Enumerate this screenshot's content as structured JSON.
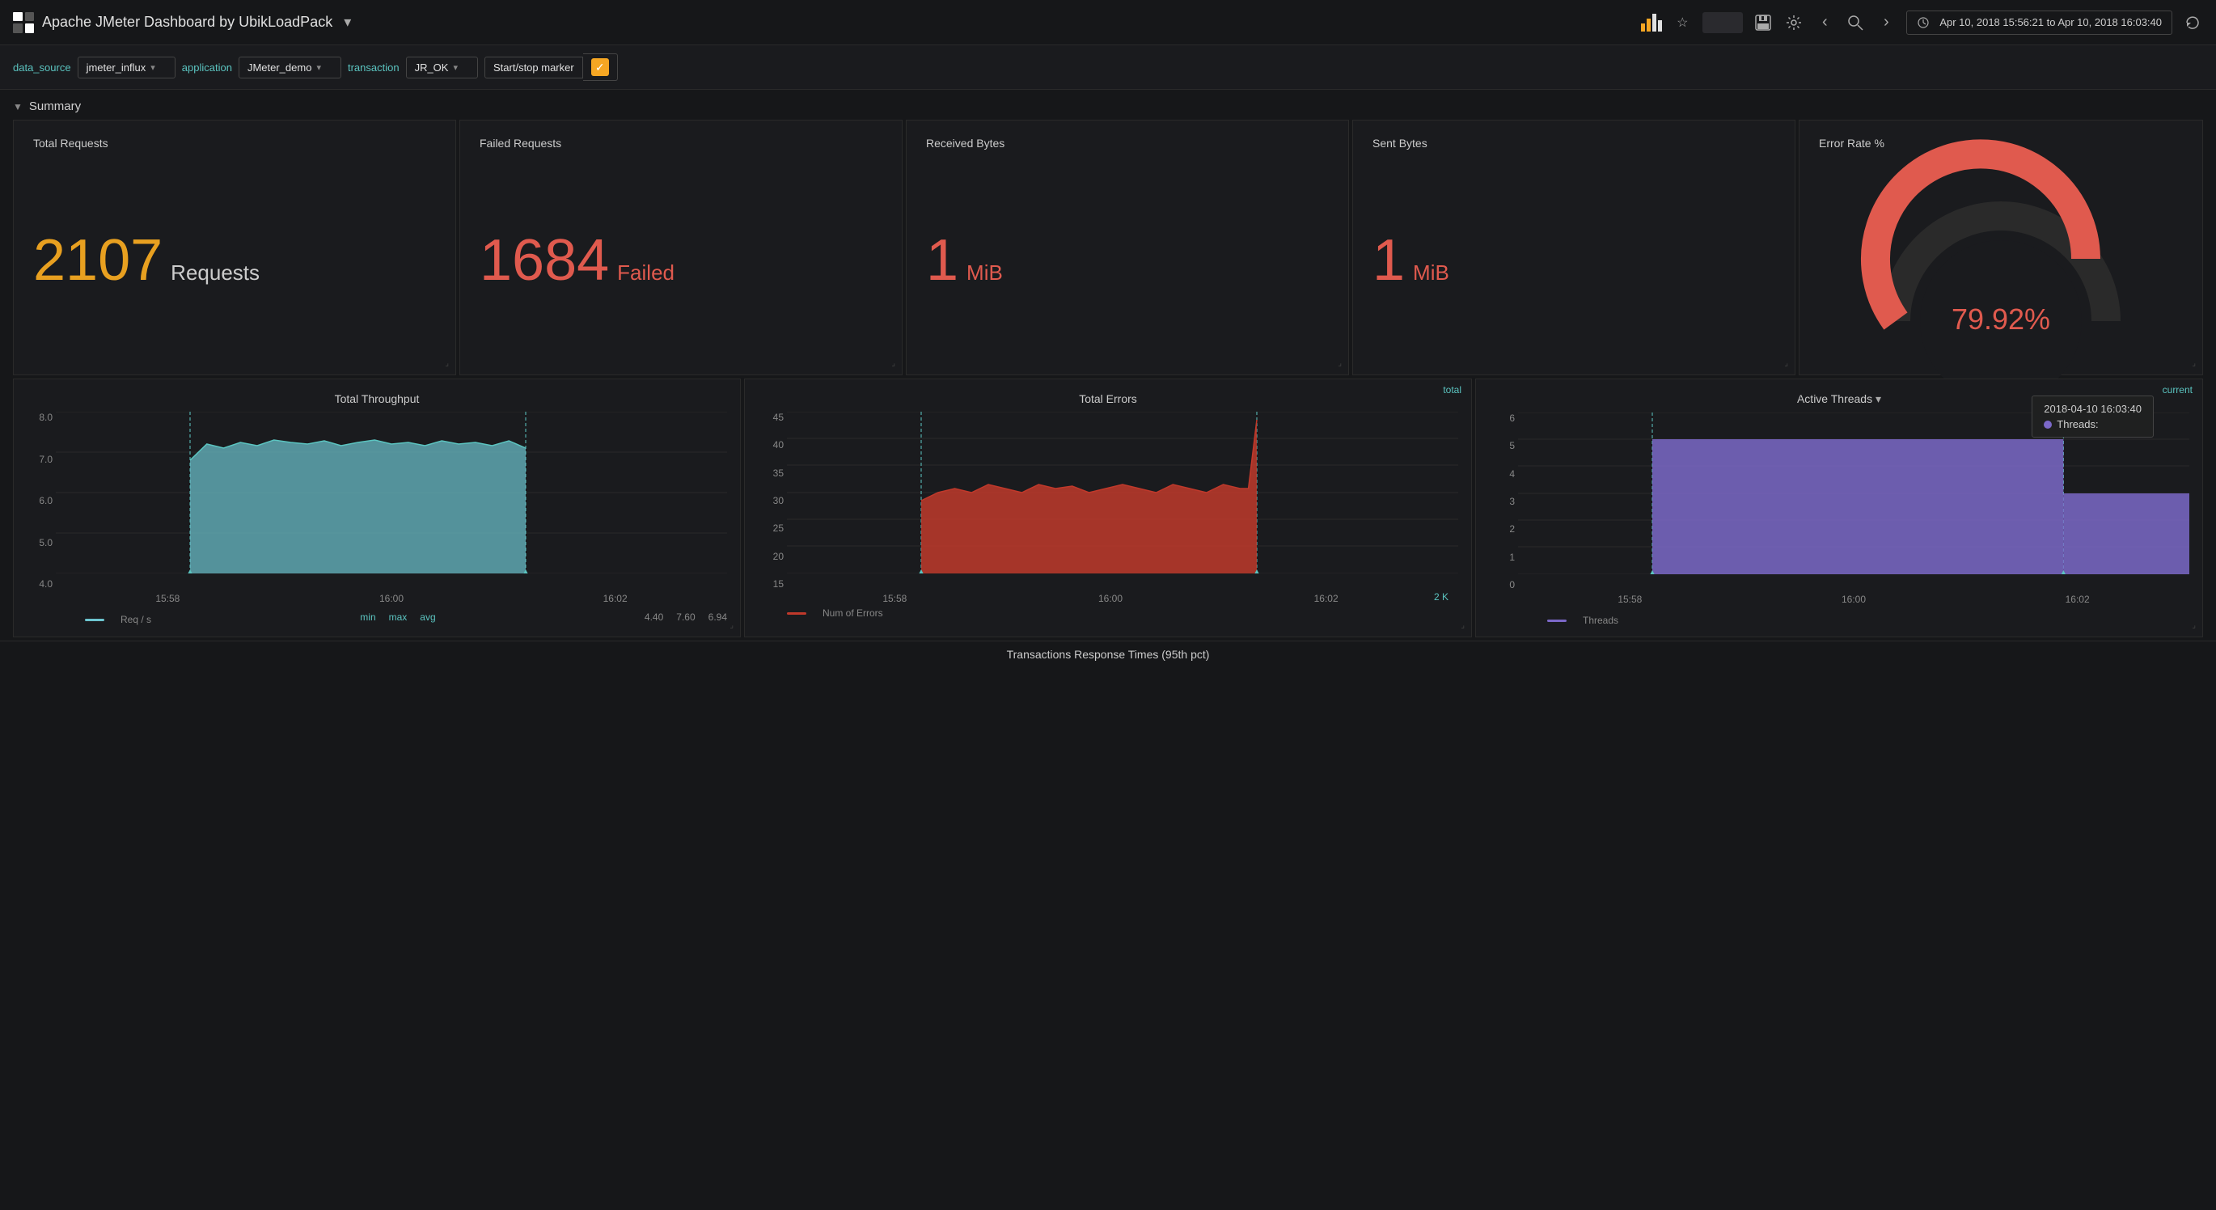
{
  "app": {
    "title": "Apache JMeter Dashboard by UbikLoadPack",
    "caret": "▾"
  },
  "topnav": {
    "star_label": "☆",
    "save_label": "💾",
    "settings_label": "⚙",
    "prev_label": "‹",
    "next_label": "›",
    "search_label": "🔍",
    "refresh_label": "↻",
    "time_range": "Apr 10, 2018  15:56:21  to  Apr 10, 2018  16:03:40"
  },
  "filterbar": {
    "data_source_label": "data_source",
    "data_source_value": "jmeter_influx",
    "application_label": "application",
    "application_value": "JMeter_demo",
    "transaction_label": "transaction",
    "transaction_value": "JR_OK",
    "start_stop_label": "Start/stop marker",
    "checkbox_checked": "✓"
  },
  "summary": {
    "section_label": "Summary",
    "collapse_icon": "▼"
  },
  "stat_cards": [
    {
      "title": "Total Requests",
      "big_num": "2107",
      "unit": "Requests",
      "num_color": "yellow",
      "unit_color": "white"
    },
    {
      "title": "Failed Requests",
      "big_num": "1684",
      "unit": "Failed",
      "num_color": "red",
      "unit_color": "red"
    },
    {
      "title": "Received Bytes",
      "big_num": "1",
      "unit": "MiB",
      "num_color": "red",
      "unit_color": "red"
    },
    {
      "title": "Sent Bytes",
      "big_num": "1",
      "unit": "MiB",
      "num_color": "red",
      "unit_color": "red"
    }
  ],
  "error_rate": {
    "title": "Error Rate %",
    "value": "79.92%",
    "percent": 79.92
  },
  "charts": [
    {
      "title": "Total Throughput",
      "y_labels": [
        "8.0",
        "7.0",
        "6.0",
        "5.0",
        "4.0"
      ],
      "x_labels": [
        "15:58",
        "16:00",
        "16:02"
      ],
      "legend_label": "Req / s",
      "legend_color": "#6dc5d0",
      "stats_min_label": "min",
      "stats_max_label": "max",
      "stats_avg_label": "avg",
      "stats_min": "4.40",
      "stats_max": "7.60",
      "stats_avg": "6.94",
      "type": "throughput"
    },
    {
      "title": "Total Errors",
      "y_labels": [
        "45",
        "40",
        "35",
        "30",
        "25",
        "20",
        "15"
      ],
      "x_labels": [
        "15:58",
        "16:00",
        "16:02"
      ],
      "legend_label": "Num of Errors",
      "legend_color": "#c0392b",
      "total_label": "total",
      "total_value": "2 K",
      "type": "errors"
    },
    {
      "title": "Active Threads",
      "title_caret": "▾",
      "y_labels": [
        "6",
        "5",
        "4",
        "3",
        "2",
        "1",
        "0"
      ],
      "x_labels": [
        "15:58",
        "16:00",
        "16:02"
      ],
      "legend_label": "Threads",
      "legend_color": "#7b68c8",
      "current_label": "current",
      "tooltip_time": "2018-04-10 16:03:40",
      "tooltip_label": "Threads:",
      "type": "threads"
    }
  ],
  "bottom_section": {
    "label": "Transactions Response Times (95th pct)"
  }
}
